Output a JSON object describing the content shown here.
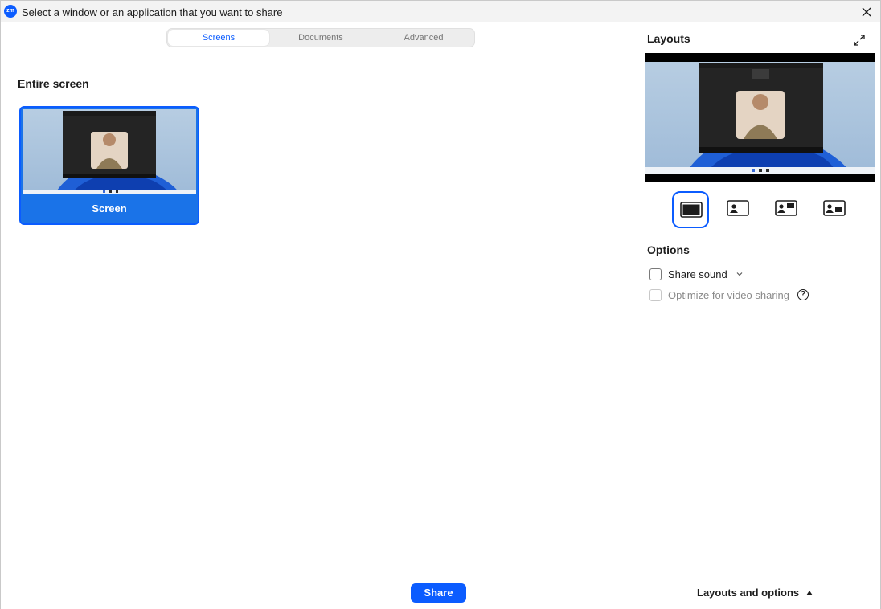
{
  "window": {
    "title": "Select a window or an application that you want to share",
    "app_icon_text": "zm",
    "accent_color": "#0b5cff"
  },
  "tabs": [
    {
      "label": "Screens",
      "active": true
    },
    {
      "label": "Documents",
      "active": false
    },
    {
      "label": "Advanced",
      "active": false
    }
  ],
  "left": {
    "section_title": "Entire screen",
    "items": [
      {
        "label": "Screen",
        "selected": true
      }
    ]
  },
  "right": {
    "layouts_title": "Layouts",
    "layout_options": [
      {
        "icon": "layout-screen-only-icon",
        "selected": true
      },
      {
        "icon": "layout-side-by-side-icon",
        "selected": false
      },
      {
        "icon": "layout-picture-in-picture-icon",
        "selected": false
      },
      {
        "icon": "layout-speaker-icon",
        "selected": false
      }
    ],
    "options_title": "Options",
    "options": [
      {
        "label": "Share sound",
        "checked": false,
        "enabled": true,
        "has_dropdown": true
      },
      {
        "label": "Optimize for video sharing",
        "checked": false,
        "enabled": false,
        "has_help": true
      }
    ],
    "help_glyph": "?"
  },
  "bottom": {
    "share_label": "Share",
    "layouts_toggle_label": "Layouts and options"
  }
}
